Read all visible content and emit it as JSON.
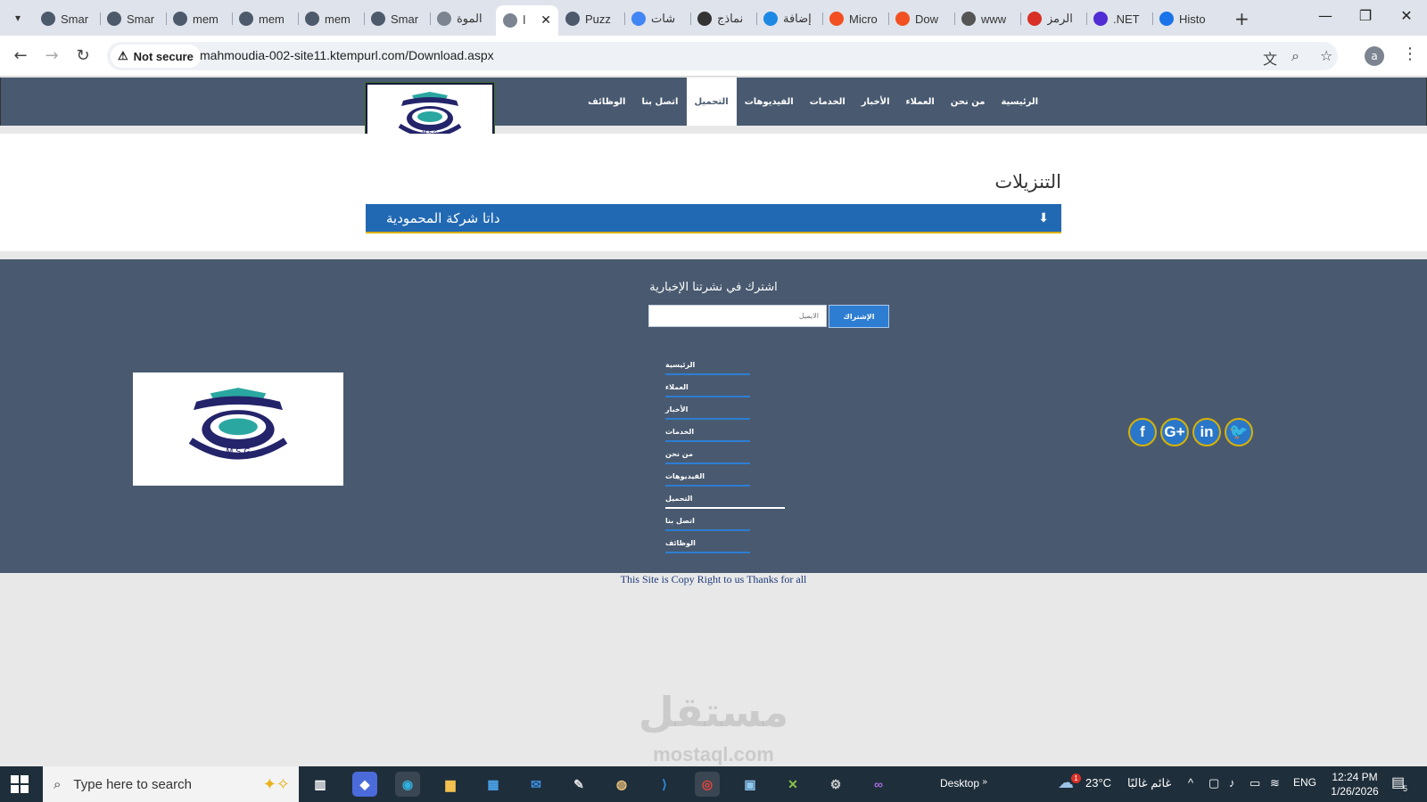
{
  "browser": {
    "tabs": [
      {
        "label": "Smar",
        "icon": "site-icon",
        "color": "#4d5a6b"
      },
      {
        "label": "Smar",
        "icon": "site-icon",
        "color": "#4d5a6b"
      },
      {
        "label": "mem",
        "icon": "site-icon",
        "color": "#4d5a6b"
      },
      {
        "label": "mem",
        "icon": "site-icon",
        "color": "#4d5a6b"
      },
      {
        "label": "mem",
        "icon": "site-icon",
        "color": "#4d5a6b"
      },
      {
        "label": "Smar",
        "icon": "site-icon",
        "color": "#4d5a6b"
      },
      {
        "label": "الموة",
        "icon": "site-logo-icon",
        "color": "#7b8490"
      },
      {
        "label": "ا",
        "icon": "site-logo-icon",
        "color": "#7b8490",
        "active": true
      },
      {
        "label": "Puzz",
        "icon": "puzzle-site-icon",
        "color": "#4d5a6b"
      },
      {
        "label": "شات",
        "icon": "google-icon",
        "color": "#4285f4"
      },
      {
        "label": "نماذج",
        "icon": "openai-icon",
        "color": "#333333"
      },
      {
        "label": "إضافة",
        "icon": "circle-site-icon",
        "color": "#1e88e5"
      },
      {
        "label": "Micro",
        "icon": "microsoft-icon",
        "color": "#f25022"
      },
      {
        "label": "Dow",
        "icon": "microsoft-icon",
        "color": "#f25022"
      },
      {
        "label": "www",
        "icon": "play-icon",
        "color": "#555555"
      },
      {
        "label": "الرمز",
        "icon": "gmail-icon",
        "color": "#d93025"
      },
      {
        "label": ".NET",
        "icon": "dotnet-icon",
        "color": "#512bd4"
      },
      {
        "label": "Histo",
        "icon": "history-icon",
        "color": "#1a73e8"
      }
    ],
    "tab_close": "✕",
    "new_tab": "+",
    "security_label": "Not secure",
    "url": "mahmoudia-002-site11.ktempurl.com/Download.aspx",
    "profile_initial": "a"
  },
  "site": {
    "nav": [
      "الرئيسية",
      "من نحن",
      "العملاء",
      "الأخبار",
      "الخدمات",
      "الفيديوهات",
      "التحميل",
      "اتصل بنا",
      "الوظائف"
    ],
    "active_nav_index": 6,
    "logo_text": "M.S.G",
    "page_title": "التنزيلات",
    "downloads": [
      {
        "label": "داتا شركة المحمودية",
        "icon": "download-icon"
      }
    ],
    "footer": {
      "newsletter_title": "اشترك في نشرتنا الإخبارية",
      "email_placeholder": "الايميل",
      "subscribe_label": "الإشتراك",
      "links": [
        "الرئيسية",
        "العملاء",
        "الأخبار",
        "الخدمات",
        "من نحن",
        "الفيديوهات",
        "التحميل",
        "اتصل بنا",
        "الوظائف"
      ],
      "active_link_index": 6,
      "social": [
        {
          "name": "facebook-icon",
          "glyph": "f"
        },
        {
          "name": "google-plus-icon",
          "glyph": "G+"
        },
        {
          "name": "linkedin-icon",
          "glyph": "in"
        },
        {
          "name": "twitter-icon",
          "glyph": "🐦"
        }
      ],
      "copyright": "This Site is Copy Right to us Thanks for all"
    },
    "watermark": "مستقل",
    "watermark_sub": "mostaql.com"
  },
  "taskbar": {
    "search_placeholder": "Type here to search",
    "desktop_label": "Desktop",
    "temperature": "23°C",
    "weather": "غائم غالبًا",
    "weather_badge": "1",
    "language": "ENG",
    "time": "12:24 PM",
    "date": "1/26/2026",
    "notification_count": "5"
  }
}
